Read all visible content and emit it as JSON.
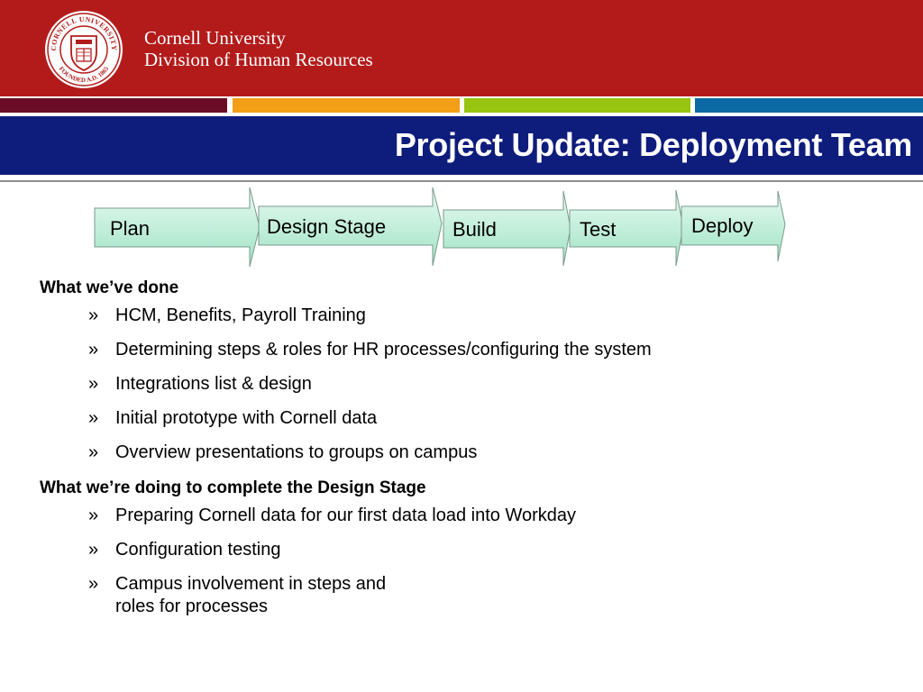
{
  "header": {
    "org_line1": "Cornell University",
    "org_line2": "Division of Human Resources",
    "seal_top_text": "CORNELL UNIVERSITY",
    "seal_bottom_text": "FOUNDED A.D. 1865"
  },
  "stripes": {
    "colors": [
      "#6b0d26",
      "#f29e16",
      "#97c410",
      "#0b6aa3"
    ]
  },
  "title": "Project Update: Deployment Team",
  "process": {
    "steps": [
      "Plan",
      "Design Stage",
      "Build",
      "Test",
      "Deploy"
    ]
  },
  "sections": [
    {
      "heading": "What we’ve done",
      "bullet": "»",
      "items": [
        "HCM, Benefits, Payroll Training",
        "Determining steps & roles for HR processes/configuring the system",
        "Integrations list & design",
        "Initial prototype with Cornell data",
        "Overview presentations to groups on campus"
      ]
    },
    {
      "heading": "What we’re doing to complete the Design Stage",
      "bullet": "»",
      "items": [
        "Preparing Cornell data for our first data load into Workday",
        "Configuration testing",
        "Campus involvement in steps and\nroles for processes"
      ]
    }
  ],
  "colors": {
    "header_red": "#b31b1b",
    "title_blue": "#0e1c7c",
    "arrow_fill_light": "#e8faf2",
    "arrow_fill_dark": "#9fe3c4"
  }
}
